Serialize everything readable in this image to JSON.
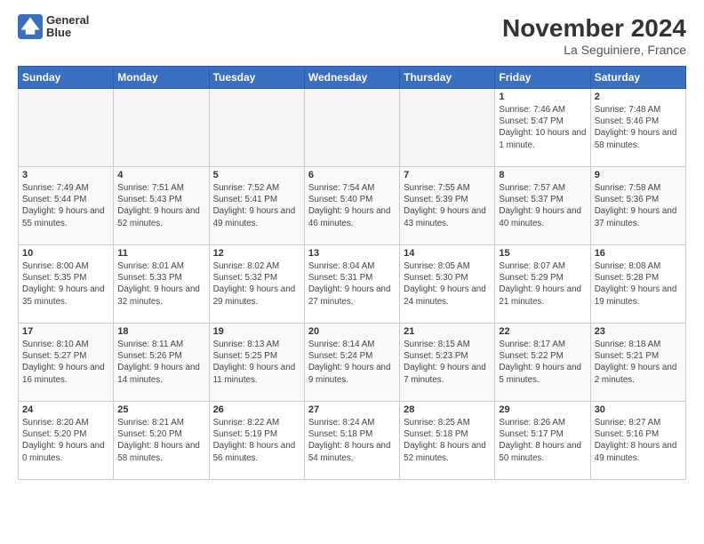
{
  "logo": {
    "line1": "General",
    "line2": "Blue"
  },
  "title": "November 2024",
  "subtitle": "La Seguiniere, France",
  "weekdays": [
    "Sunday",
    "Monday",
    "Tuesday",
    "Wednesday",
    "Thursday",
    "Friday",
    "Saturday"
  ],
  "weeks": [
    [
      {
        "day": "",
        "info": ""
      },
      {
        "day": "",
        "info": ""
      },
      {
        "day": "",
        "info": ""
      },
      {
        "day": "",
        "info": ""
      },
      {
        "day": "",
        "info": ""
      },
      {
        "day": "1",
        "info": "Sunrise: 7:46 AM\nSunset: 5:47 PM\nDaylight: 10 hours and 1 minute."
      },
      {
        "day": "2",
        "info": "Sunrise: 7:48 AM\nSunset: 5:46 PM\nDaylight: 9 hours and 58 minutes."
      }
    ],
    [
      {
        "day": "3",
        "info": "Sunrise: 7:49 AM\nSunset: 5:44 PM\nDaylight: 9 hours and 55 minutes."
      },
      {
        "day": "4",
        "info": "Sunrise: 7:51 AM\nSunset: 5:43 PM\nDaylight: 9 hours and 52 minutes."
      },
      {
        "day": "5",
        "info": "Sunrise: 7:52 AM\nSunset: 5:41 PM\nDaylight: 9 hours and 49 minutes."
      },
      {
        "day": "6",
        "info": "Sunrise: 7:54 AM\nSunset: 5:40 PM\nDaylight: 9 hours and 46 minutes."
      },
      {
        "day": "7",
        "info": "Sunrise: 7:55 AM\nSunset: 5:39 PM\nDaylight: 9 hours and 43 minutes."
      },
      {
        "day": "8",
        "info": "Sunrise: 7:57 AM\nSunset: 5:37 PM\nDaylight: 9 hours and 40 minutes."
      },
      {
        "day": "9",
        "info": "Sunrise: 7:58 AM\nSunset: 5:36 PM\nDaylight: 9 hours and 37 minutes."
      }
    ],
    [
      {
        "day": "10",
        "info": "Sunrise: 8:00 AM\nSunset: 5:35 PM\nDaylight: 9 hours and 35 minutes."
      },
      {
        "day": "11",
        "info": "Sunrise: 8:01 AM\nSunset: 5:33 PM\nDaylight: 9 hours and 32 minutes."
      },
      {
        "day": "12",
        "info": "Sunrise: 8:02 AM\nSunset: 5:32 PM\nDaylight: 9 hours and 29 minutes."
      },
      {
        "day": "13",
        "info": "Sunrise: 8:04 AM\nSunset: 5:31 PM\nDaylight: 9 hours and 27 minutes."
      },
      {
        "day": "14",
        "info": "Sunrise: 8:05 AM\nSunset: 5:30 PM\nDaylight: 9 hours and 24 minutes."
      },
      {
        "day": "15",
        "info": "Sunrise: 8:07 AM\nSunset: 5:29 PM\nDaylight: 9 hours and 21 minutes."
      },
      {
        "day": "16",
        "info": "Sunrise: 8:08 AM\nSunset: 5:28 PM\nDaylight: 9 hours and 19 minutes."
      }
    ],
    [
      {
        "day": "17",
        "info": "Sunrise: 8:10 AM\nSunset: 5:27 PM\nDaylight: 9 hours and 16 minutes."
      },
      {
        "day": "18",
        "info": "Sunrise: 8:11 AM\nSunset: 5:26 PM\nDaylight: 9 hours and 14 minutes."
      },
      {
        "day": "19",
        "info": "Sunrise: 8:13 AM\nSunset: 5:25 PM\nDaylight: 9 hours and 11 minutes."
      },
      {
        "day": "20",
        "info": "Sunrise: 8:14 AM\nSunset: 5:24 PM\nDaylight: 9 hours and 9 minutes."
      },
      {
        "day": "21",
        "info": "Sunrise: 8:15 AM\nSunset: 5:23 PM\nDaylight: 9 hours and 7 minutes."
      },
      {
        "day": "22",
        "info": "Sunrise: 8:17 AM\nSunset: 5:22 PM\nDaylight: 9 hours and 5 minutes."
      },
      {
        "day": "23",
        "info": "Sunrise: 8:18 AM\nSunset: 5:21 PM\nDaylight: 9 hours and 2 minutes."
      }
    ],
    [
      {
        "day": "24",
        "info": "Sunrise: 8:20 AM\nSunset: 5:20 PM\nDaylight: 9 hours and 0 minutes."
      },
      {
        "day": "25",
        "info": "Sunrise: 8:21 AM\nSunset: 5:20 PM\nDaylight: 8 hours and 58 minutes."
      },
      {
        "day": "26",
        "info": "Sunrise: 8:22 AM\nSunset: 5:19 PM\nDaylight: 8 hours and 56 minutes."
      },
      {
        "day": "27",
        "info": "Sunrise: 8:24 AM\nSunset: 5:18 PM\nDaylight: 8 hours and 54 minutes."
      },
      {
        "day": "28",
        "info": "Sunrise: 8:25 AM\nSunset: 5:18 PM\nDaylight: 8 hours and 52 minutes."
      },
      {
        "day": "29",
        "info": "Sunrise: 8:26 AM\nSunset: 5:17 PM\nDaylight: 8 hours and 50 minutes."
      },
      {
        "day": "30",
        "info": "Sunrise: 8:27 AM\nSunset: 5:16 PM\nDaylight: 8 hours and 49 minutes."
      }
    ]
  ]
}
